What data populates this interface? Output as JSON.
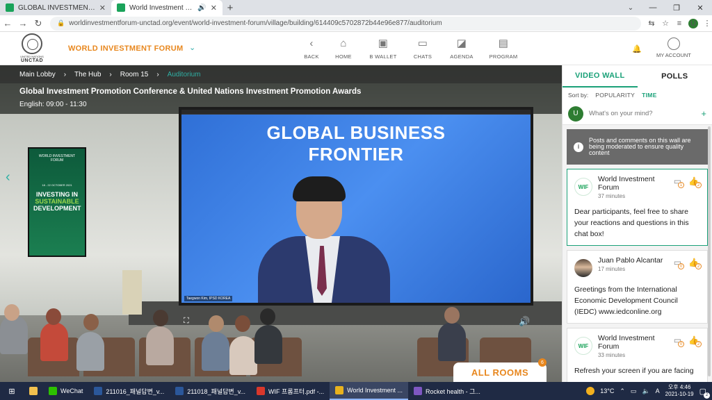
{
  "browser": {
    "tabs": [
      {
        "title": "GLOBAL INVESTMENT PROMOTI",
        "active": false
      },
      {
        "title": "World Investment Forum - ",
        "active": true
      }
    ],
    "url": "worldinvestmentforum-unctad.org/event/world-investment-forum/village/building/614409c5702872b44e96e877/auditorium",
    "profile_initial": "U"
  },
  "header": {
    "org_small": "UNITED NATIONS",
    "org": "UNCTAD",
    "forum_title": "WORLD INVESTMENT FORUM",
    "nav": [
      {
        "label": "BACK",
        "icon": "back-arrow-icon",
        "glyph": "‹"
      },
      {
        "label": "HOME",
        "icon": "home-icon",
        "glyph": "⌂"
      },
      {
        "label": "B WALLET",
        "icon": "wallet-icon",
        "glyph": "▣"
      },
      {
        "label": "CHATS",
        "icon": "chat-icon",
        "glyph": "▭"
      },
      {
        "label": "AGENDA",
        "icon": "agenda-icon",
        "glyph": "◪"
      },
      {
        "label": "PROGRAM",
        "icon": "program-icon",
        "glyph": "▤"
      }
    ],
    "account_label": "MY ACCOUNT"
  },
  "breadcrumb": [
    "Main Lobby",
    "The Hub",
    "Room 15",
    "Auditorium"
  ],
  "session": {
    "title": "Global Investment Promotion Conference & United Nations Investment Promotion Awards",
    "time": "English: 09:00 - 11:30"
  },
  "video": {
    "heading_line1": "GLOBAL BUSINESS",
    "heading_line2": "FRONTIER",
    "name_tag": "Taegwon Kim, IPSD KOREA"
  },
  "poster": {
    "logo": "WORLD INVESTMENT FORUM",
    "date": "18 - 22 OCTOBER 2021",
    "line1": "INVESTING IN",
    "line2": "SUSTAINABLE",
    "line3": "DEVELOPMENT"
  },
  "all_rooms": {
    "label": "ALL ROOMS",
    "count": "6"
  },
  "panel": {
    "tabs": [
      {
        "label": "VIDEO WALL",
        "active": true
      },
      {
        "label": "POLLS",
        "active": false
      }
    ],
    "sort_label": "Sort by:",
    "sort_options": [
      {
        "label": "POPULARITY",
        "selected": false
      },
      {
        "label": "TIME",
        "selected": true
      }
    ],
    "compose_placeholder": "What's on your mind?",
    "user_initial": "U",
    "notice": "Posts and comments on this wall are being moderated to ensure quality content",
    "posts": [
      {
        "author": "World Investment Forum",
        "time": "37 minutes",
        "avatar": "WIF",
        "comments": "1",
        "likes": "2",
        "highlight": true,
        "body": "Dear participants, feel free to share your reactions and questions in this chat box!"
      },
      {
        "author": "Juan Pablo Alcantar",
        "time": "17 minutes",
        "avatar": "",
        "comments": "0",
        "likes": "2",
        "highlight": false,
        "body": "Greetings from the International Economic Development Council (IEDC) www.iedconline.org"
      },
      {
        "author": "World Investment Forum",
        "time": "33 minutes",
        "avatar": "WIF",
        "comments": "0",
        "likes": "2",
        "highlight": false,
        "body": "Refresh your screen if you are facing"
      }
    ]
  },
  "taskbar": {
    "items": [
      {
        "label": "WeChat",
        "color": "#2dc100"
      },
      {
        "label": "211016_패널답변_v...",
        "color": "#2b579a"
      },
      {
        "label": "211018_패널답변_v...",
        "color": "#2b579a"
      },
      {
        "label": "WIF 프롬프터.pdf -...",
        "color": "#d9372b"
      },
      {
        "label": "World Investment ...",
        "color": "#e8b21e",
        "active": true
      },
      {
        "label": "Rocket health - 그...",
        "color": "#7e57c2"
      }
    ],
    "temperature": "13°C",
    "time": "오후 4:46",
    "date": "2021-10-19",
    "notifications": "2"
  }
}
